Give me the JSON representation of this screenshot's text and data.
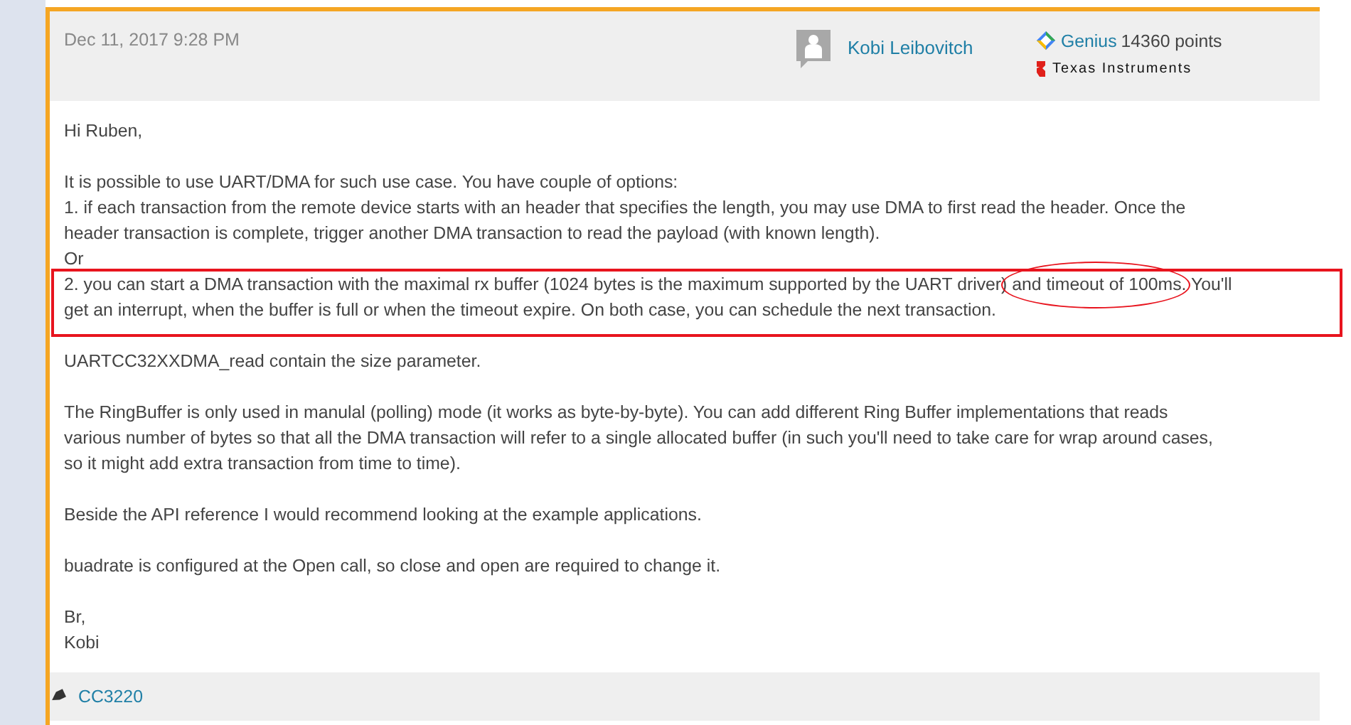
{
  "post": {
    "date": "Dec 11, 2017 9:28 PM",
    "author": "Kobi Leibovitch",
    "rank": "Genius",
    "points": "14360 points",
    "company": "Texas Instruments"
  },
  "paragraphs": [
    {
      "lines": [
        "Hi Ruben,"
      ],
      "highlighted": false
    },
    {
      "lines": [
        "It is possible to use UART/DMA for such use case. You have couple of options:",
        "1. if each transaction from the remote device starts with an header that specifies the length, you may use DMA to first read the header. Once the",
        "header transaction is complete, trigger another DMA transaction to read the payload (with known length).",
        "Or"
      ],
      "highlighted": false
    },
    {
      "lines": [
        {
          "before": "2. you can start a DMA transaction with the maximal rx buffer (1024 bytes is the maximum supported by the UART driver) ",
          "circled": "and timeout of 100ms",
          "after": ". You'll"
        },
        "get an interrupt, when the buffer is full or when the timeout expire. On both case, you can schedule the next transaction."
      ],
      "highlighted": true
    },
    {
      "lines": [
        "UARTCC32XXDMA_read contain the size parameter."
      ],
      "highlighted": false
    },
    {
      "lines": [
        "The RingBuffer is only used in manulal (polling) mode (it works as byte-by-byte). You can add different Ring Buffer implementations that reads",
        "various number of bytes so that all the DMA transaction will refer to a single allocated buffer (in such you'll need to take care for wrap around cases,",
        "so it might add extra transaction from time to time)."
      ],
      "highlighted": false
    },
    {
      "lines": [
        "Beside the API reference I would recommend looking at the example applications."
      ],
      "highlighted": false
    },
    {
      "lines": [
        "buadrate is configured at the Open call, so close and open are required to change it."
      ],
      "highlighted": false
    },
    {
      "lines": [
        "Br,",
        "Kobi"
      ],
      "highlighted": false
    }
  ],
  "tags": [
    "CC3220"
  ]
}
